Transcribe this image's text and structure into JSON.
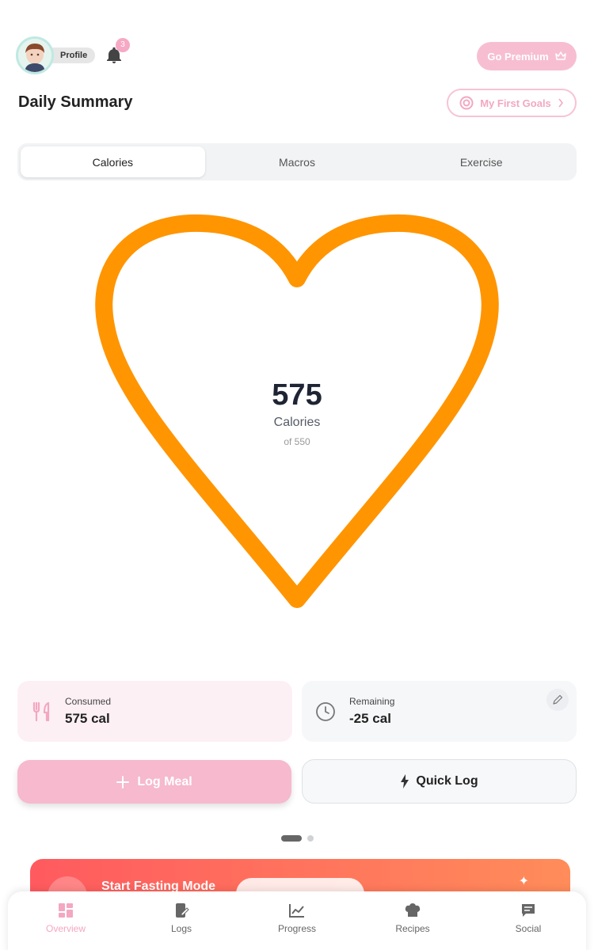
{
  "header": {
    "profile_label": "Profile",
    "notification_count": "3",
    "premium_label": "Go Premium",
    "title": "Daily Summary",
    "goals_label": "My First Goals"
  },
  "tabs": [
    {
      "label": "Calories",
      "active": true
    },
    {
      "label": "Macros",
      "active": false
    },
    {
      "label": "Exercise",
      "active": false
    }
  ],
  "summary": {
    "value": "575",
    "unit_label": "Calories",
    "goal_label": "of 550",
    "ring_color": "#ff9500"
  },
  "stats": {
    "consumed": {
      "label": "Consumed",
      "value": "575 cal"
    },
    "remaining": {
      "label": "Remaining",
      "value": "-25 cal"
    }
  },
  "actions": {
    "log_meal": "Log Meal",
    "quick_log": "Quick Log"
  },
  "pager": {
    "pages": 2,
    "current": 1
  },
  "fasting": {
    "title": "Start Fasting Mode"
  },
  "bottom_nav": [
    {
      "label": "Overview",
      "icon": "grid-icon",
      "active": true
    },
    {
      "label": "Logs",
      "icon": "notebook-icon",
      "active": false
    },
    {
      "label": "Progress",
      "icon": "chart-icon",
      "active": false
    },
    {
      "label": "Recipes",
      "icon": "chef-hat-icon",
      "active": false
    },
    {
      "label": "Social",
      "icon": "chat-icon",
      "active": false
    }
  ],
  "colors": {
    "accent_pink": "#f6b9cd",
    "heart_orange": "#ff9500",
    "fasting_gradient_start": "#ff5a5f",
    "fasting_gradient_end": "#ff8c5a"
  }
}
